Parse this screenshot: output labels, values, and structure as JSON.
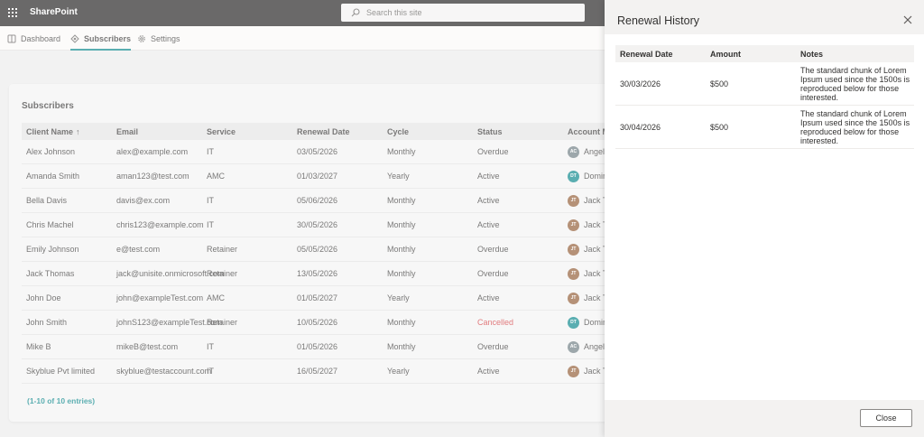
{
  "app": {
    "brand": "SharePoint"
  },
  "search": {
    "placeholder": "Search this site"
  },
  "nav": [
    {
      "label": "Dashboard",
      "icon": "dashboard-icon"
    },
    {
      "label": "Subscribers",
      "icon": "subscribers-icon",
      "active": true
    },
    {
      "label": "Settings",
      "icon": "gear-icon"
    }
  ],
  "subscribers": {
    "title": "Subscribers",
    "columns": [
      "Client Name",
      "Email",
      "Service",
      "Renewal Date",
      "Cycle",
      "Status",
      "Account Ma"
    ],
    "sort_indicator": "↑",
    "rows": [
      {
        "name": "Alex Johnson",
        "email": "alex@example.com",
        "service": "IT",
        "date": "03/05/2026",
        "cycle": "Monthly",
        "status": "Overdue",
        "initials": "AC",
        "avatar_color": "#69797e",
        "manager": "Angela"
      },
      {
        "name": "Amanda Smith",
        "email": "aman123@test.com",
        "service": "AMC",
        "date": "01/03/2027",
        "cycle": "Yearly",
        "status": "Active",
        "initials": "DT",
        "avatar_color": "#038387",
        "manager": "Domin"
      },
      {
        "name": "Bella Davis",
        "email": "davis@ex.com",
        "service": "IT",
        "date": "05/06/2026",
        "cycle": "Monthly",
        "status": "Active",
        "initials": "JT",
        "avatar_color": "#8e562e",
        "manager": "Jack Th"
      },
      {
        "name": "Chris Machel",
        "email": "chris123@example.com",
        "service": "IT",
        "date": "30/05/2026",
        "cycle": "Monthly",
        "status": "Active",
        "initials": "JT",
        "avatar_color": "#8e562e",
        "manager": "Jack Th"
      },
      {
        "name": "Emily Johnson",
        "email": "e@test.com",
        "service": "Retainer",
        "date": "05/05/2026",
        "cycle": "Monthly",
        "status": "Overdue",
        "initials": "JT",
        "avatar_color": "#8e562e",
        "manager": "Jack Th"
      },
      {
        "name": "Jack Thomas",
        "email": "jack@unisite.onmicrosoft.com",
        "service": "Retainer",
        "date": "13/05/2026",
        "cycle": "Monthly",
        "status": "Overdue",
        "initials": "JT",
        "avatar_color": "#8e562e",
        "manager": "Jack Th"
      },
      {
        "name": "John Doe",
        "email": "john@exampleTest.com",
        "service": "AMC",
        "date": "01/05/2027",
        "cycle": "Yearly",
        "status": "Active",
        "initials": "JT",
        "avatar_color": "#8e562e",
        "manager": "Jack Th"
      },
      {
        "name": "John Smith",
        "email": "johnS123@exampleTest.com",
        "service": "Retainer",
        "date": "10/05/2026",
        "cycle": "Monthly",
        "status": "Cancelled",
        "initials": "DT",
        "avatar_color": "#038387",
        "manager": "Domin"
      },
      {
        "name": "Mike B",
        "email": "mikeB@test.com",
        "service": "IT",
        "date": "01/05/2026",
        "cycle": "Monthly",
        "status": "Overdue",
        "initials": "AC",
        "avatar_color": "#69797e",
        "manager": "Angela"
      },
      {
        "name": "Skyblue Pvt limited",
        "email": "skyblue@testaccount.com",
        "service": "IT",
        "date": "16/05/2027",
        "cycle": "Yearly",
        "status": "Active",
        "initials": "JT",
        "avatar_color": "#8e562e",
        "manager": "Jack Th"
      }
    ],
    "footer": "(1-10 of 10 entries)"
  },
  "panel": {
    "title": "Renewal History",
    "columns": [
      "Renewal Date",
      "Amount",
      "Notes"
    ],
    "rows": [
      {
        "date": "30/03/2026",
        "amount": "$500",
        "notes": "The standard chunk of Lorem Ipsum used since the 1500s is reproduced below for those interested."
      },
      {
        "date": "30/04/2026",
        "amount": "$500",
        "notes": "The standard chunk of Lorem Ipsum used since the 1500s is reproduced below for those interested."
      }
    ],
    "close_label": "Close"
  },
  "colors": {
    "accent": "#038387",
    "cancelled": "#d13438",
    "topbar": "#1b1a19"
  }
}
